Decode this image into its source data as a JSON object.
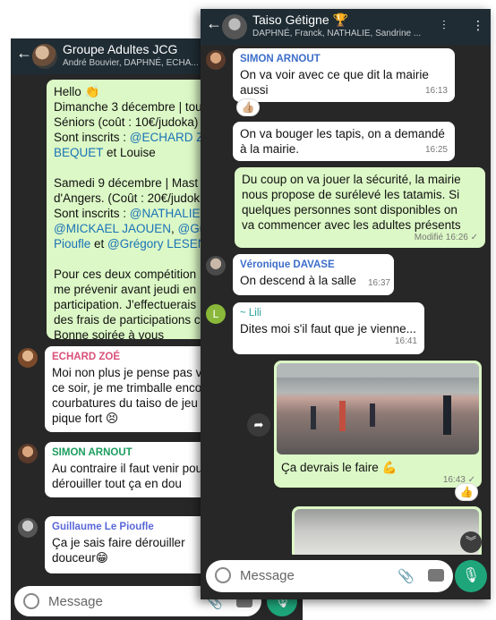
{
  "back": {
    "title": "Groupe Adultes JCG",
    "subtitle": "André Bouvier, DAPHNÉ, ECHA...",
    "msg1": {
      "l1": "Hello 👏",
      "l2": "Dimanche 3 décembre | tou",
      "l3": "Séniors (coût : 10€/judoka)",
      "l4a": "Sont inscrits : ",
      "l4b": "@ECHARD Z",
      "l5a": "BEQUET",
      "l5b": " et Louise",
      "l6": "Samedi 9 décembre | Mast",
      "l7": "d'Angers. (Coût : 20€/judok",
      "l8a": "Sont inscrits : ",
      "l8b": "@NATHALIE",
      "l9a": "@MICKAEL JAOUEN",
      "l9b": ", ",
      "l9c": "@Gui",
      "l10a": "Pioufle",
      "l10b": " et ",
      "l10c": "@Grégory LESEN",
      "l11": "Pour ces deux compétition",
      "l12": "me prévenir avant jeudi en",
      "l13": "participation. J'effectuerais",
      "l14": "des frais de participations c",
      "l15": "Bonne soirée à vous"
    },
    "msg2": {
      "sender": "ECHARD ZOÉ",
      "l1": "Moi non plus je pense pas v",
      "l2": "ce soir, je me trimballe enco",
      "l3": "courbatures du taiso de jeu",
      "l4": "pique fort 😣"
    },
    "msg3": {
      "sender": "SIMON ARNOUT",
      "l1": "Au contraire il faut venir pou",
      "l2": "dérouiller tout ça en dou"
    },
    "msg4": {
      "sender": "Guillaume Le Pioufle",
      "l1": "Ça je sais faire dérouiller",
      "l2": "douceur😁"
    },
    "input_placeholder": "Message"
  },
  "front": {
    "title": "Taiso Gétigne 🏆",
    "subtitle": "DAPHNÉ, Franck, NATHALIE, Sandrine ...",
    "m1": {
      "sender": "SIMON ARNOUT",
      "l1": "On va voir avec ce que dit la mairie",
      "l2": "aussi",
      "time": "16:13",
      "react": "👍🏼"
    },
    "m2": {
      "l1": "On va bouger les tapis, on a demandé",
      "l2": "à la mairie.",
      "time": "16:25"
    },
    "m3": {
      "l1": "Du coup on va jouer la sécurité, la mairie",
      "l2": "nous propose de surélevé les tatamis. Si",
      "l3": "quelques personnes sont disponibles on",
      "l4": "va commencer avec les adultes présents",
      "time": "Modifié 16:26 ✓"
    },
    "m4": {
      "sender": "Véronique DAVASE",
      "l1": "On descend à la salle",
      "time": "16:37"
    },
    "m5": {
      "sender": "~ Lili",
      "l1": "Dites moi s'il faut que je vienne...",
      "time": "16:41",
      "avatar_letter": "L"
    },
    "m6": {
      "caption": "Ça devrais le faire 💪",
      "time": "16:43 ✓",
      "react": "👍"
    },
    "input_placeholder": "Message"
  },
  "colors": {
    "header": "#1f2c34",
    "chat_bg": "#272727",
    "incoming": "#ffffff",
    "outgoing": "#dcf8c6",
    "mic": "#1ea67a"
  }
}
